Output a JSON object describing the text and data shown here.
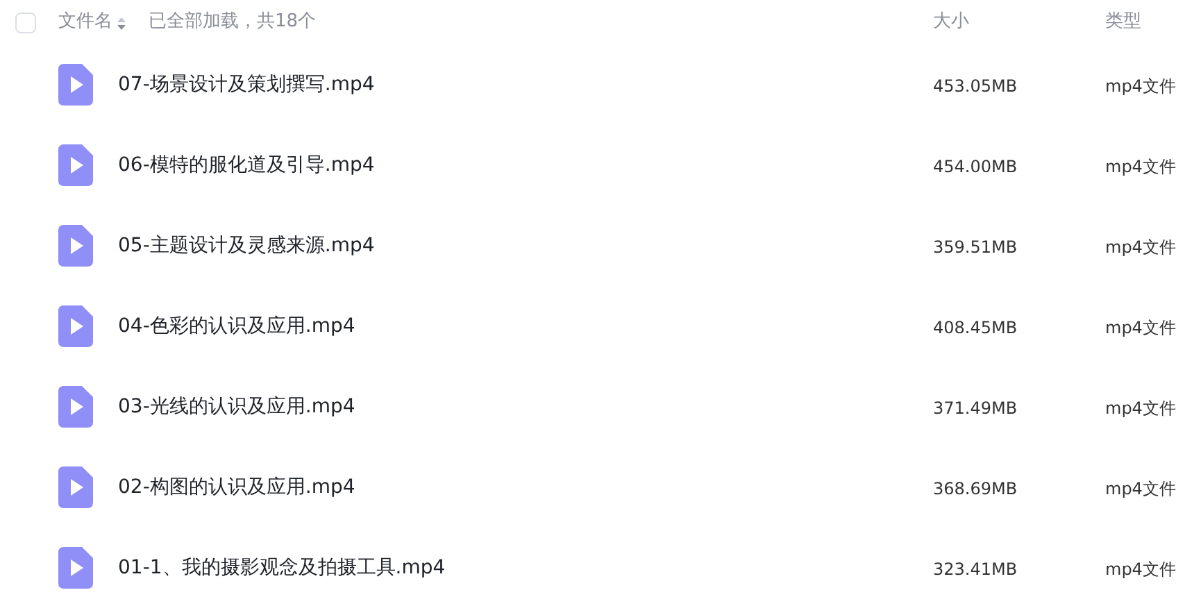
{
  "header": {
    "select_all": {
      "checked": false
    },
    "name_column": "文件名",
    "load_status": "已全部加载，共18个",
    "size_column": "大小",
    "type_column": "类型"
  },
  "files": [
    {
      "name": "07-场景设计及策划撰写.mp4",
      "size": "453.05MB",
      "type": "mp4文件",
      "kind": "video"
    },
    {
      "name": "06-模特的服化道及引导.mp4",
      "size": "454.00MB",
      "type": "mp4文件",
      "kind": "video"
    },
    {
      "name": "05-主题设计及灵感来源.mp4",
      "size": "359.51MB",
      "type": "mp4文件",
      "kind": "video"
    },
    {
      "name": "04-色彩的认识及应用.mp4",
      "size": "408.45MB",
      "type": "mp4文件",
      "kind": "video"
    },
    {
      "name": "03-光线的认识及应用.mp4",
      "size": "371.49MB",
      "type": "mp4文件",
      "kind": "video"
    },
    {
      "name": "02-构图的认识及应用.mp4",
      "size": "368.69MB",
      "type": "mp4文件",
      "kind": "video"
    },
    {
      "name": "01-1、我的摄影观念及拍摄工具.mp4",
      "size": "323.41MB",
      "type": "mp4文件",
      "kind": "video"
    }
  ]
}
